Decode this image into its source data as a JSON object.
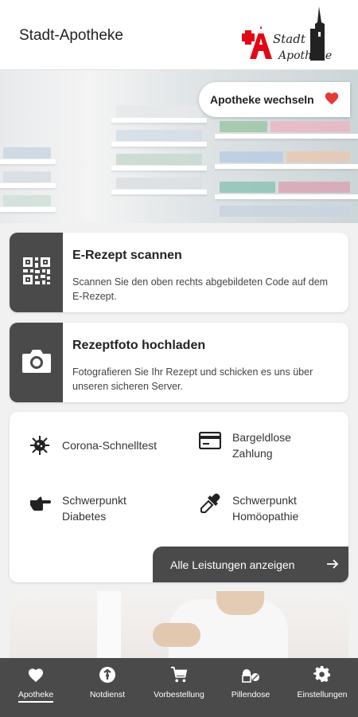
{
  "header": {
    "title": "Stadt-Apotheke",
    "logo_line1": "Stadt",
    "logo_line2": "Apotheke"
  },
  "hero": {
    "switch_label": "Apotheke wechseln",
    "switch_icon": "heart-icon",
    "accent_color": "#e53935"
  },
  "cards": [
    {
      "title": "E-Rezept scannen",
      "description": "Scannen Sie den oben rechts abgebildeten Code auf dem E-Rezept.",
      "icon": "qr-code-icon"
    },
    {
      "title": "Rezeptfoto hochladen",
      "description": "Fotografieren Sie Ihr Rezept und schicken es uns über unseren sicheren Server.",
      "icon": "camera-icon"
    }
  ],
  "services": {
    "items": [
      {
        "label": "Corona-Schnelltest",
        "icon": "virus-icon"
      },
      {
        "label": "Bargeldlose Zahlung",
        "icon": "credit-card-icon"
      },
      {
        "label": "Schwerpunkt Diabetes",
        "icon": "pointing-hand-icon"
      },
      {
        "label": "Schwerpunkt Homöopathie",
        "icon": "pipette-icon"
      }
    ],
    "all_label": "Alle Leistungen anzeigen"
  },
  "nav": {
    "items": [
      {
        "label": "Apotheke",
        "icon": "heart-icon",
        "active": true
      },
      {
        "label": "Notdienst",
        "icon": "emergency-icon"
      },
      {
        "label": "Vorbestellung",
        "icon": "cart-icon"
      },
      {
        "label": "Pillendose",
        "icon": "pills-icon"
      },
      {
        "label": "Einstellungen",
        "icon": "gear-icon"
      }
    ]
  },
  "colors": {
    "dark": "#4a4a4a",
    "brand_red": "#e30613"
  }
}
